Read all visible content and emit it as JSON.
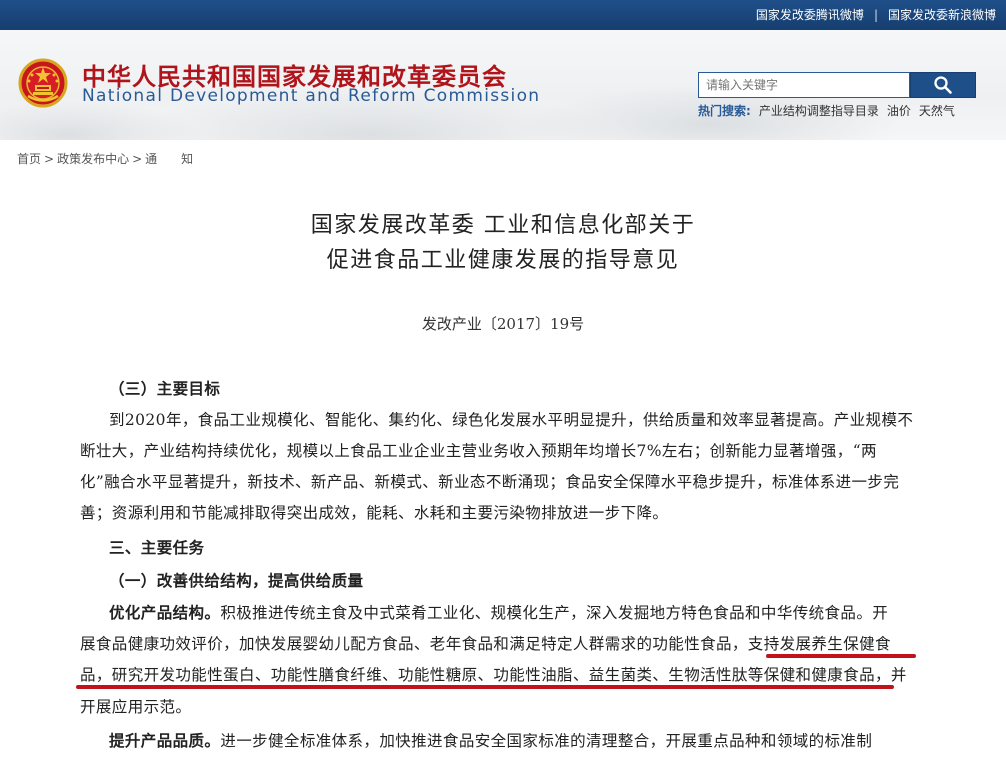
{
  "top_links": [
    "国家发改委腾讯微博",
    "国家发改委新浪微博"
  ],
  "top_sep": "|",
  "site": {
    "name_cn": "中华人民共和国国家发展和改革委员会",
    "name_en": "National Development and Reform Commission"
  },
  "search": {
    "placeholder": "请输入关键字",
    "hot_label": "热门搜索:",
    "hot_terms": [
      "产业结构调整指导目录",
      "油价",
      "天然气"
    ]
  },
  "breadcrumb": {
    "items": [
      "首页",
      "政策发布中心",
      "通　　知"
    ],
    "sep": ">"
  },
  "article": {
    "title_line1": "国家发展改革委 工业和信息化部关于",
    "title_line2": "促进食品工业健康发展的指导意见",
    "doc_number": "发改产业〔2017〕19号",
    "section_goal_heading": "（三）主要目标",
    "goal_lines": [
      "到2020年，食品工业规模化、智能化、集约化、绿色化发展水平明显提升，供给质量和效率显著提高。产业规模不",
      "断壮大，产业结构持续优化，规模以上食品工业企业主营业务收入预期年均增长7%左右；创新能力显著增强，“两",
      "化”融合水平显著提升，新技术、新产品、新模式、新业态不断涌现；食品安全保障水平稳步提升，标准体系进一步完",
      "善；资源利用和节能减排取得突出成效，能耗、水耗和主要污染物排放进一步下降。"
    ],
    "section_tasks_heading": "三、主要任务",
    "subsection_heading": "（一）改善供给结构，提高供给质量",
    "para1_lead": "优化产品结构。",
    "para1_line1_rest": "积极推进传统主食及中式菜肴工业化、规模化生产，深入发掘地方特色食品和中华传统食品。开",
    "para1_line2": "展食品健康功效评价，加快发展婴幼儿配方食品、老年食品和满足特定人群需求的功能性食品，支持发展养生保健食",
    "para1_line3": "品，研究开发功能性蛋白、功能性膳食纤维、功能性糖原、功能性油脂、益生菌类、生物活性肽等保健和健康食品，并",
    "para1_line4": "开展应用示范。",
    "para2_lead": "提升产品品质。",
    "para2_rest": "进一步健全标准体系，加快推进食品安全国家标准的清理整合，开展重点品种和领域的标准制"
  },
  "colors": {
    "top_bar": "#1f4f89",
    "site_name_cn": "#b0141a",
    "site_name_en": "#2a5a95",
    "highlight_underline": "#c0141c"
  }
}
